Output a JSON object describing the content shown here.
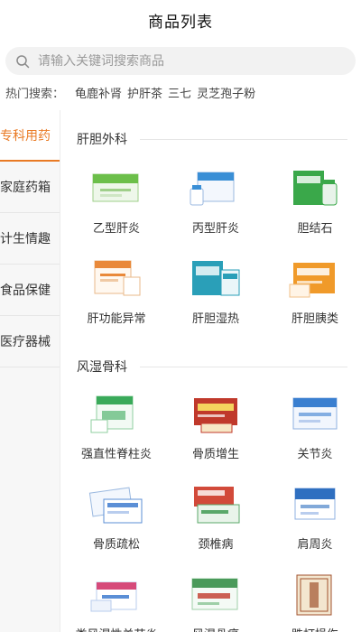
{
  "header": {
    "title": "商品列表"
  },
  "search": {
    "placeholder": "请输入关键词搜索商品",
    "icon": "search-icon"
  },
  "hot": {
    "label": "热门搜索：",
    "items": [
      "龟鹿补肾",
      "护肝茶",
      "三七",
      "灵芝孢子粉"
    ]
  },
  "sidebar": {
    "items": [
      {
        "label": "专科用药",
        "active": true
      },
      {
        "label": "家庭药箱"
      },
      {
        "label": "计生情趣"
      },
      {
        "label": "食品保健"
      },
      {
        "label": "医疗器械"
      }
    ]
  },
  "sections": [
    {
      "title": "肝胆外科",
      "items": [
        {
          "label": "乙型肝炎",
          "icon": "green-drug-box-icon",
          "color": "#6cbf4a"
        },
        {
          "label": "丙型肝炎",
          "icon": "blue-drug-box-bottle-icon",
          "color": "#3a8fd6"
        },
        {
          "label": "胆结石",
          "icon": "green-box-bottle-icon",
          "color": "#3aa84a"
        },
        {
          "label": "肝功能异常",
          "icon": "orange-drug-box-icon",
          "color": "#e9893a"
        },
        {
          "label": "肝胆湿热",
          "icon": "teal-drug-box-icon",
          "color": "#2a9fb8"
        },
        {
          "label": "肝胆胰类",
          "icon": "orange-blister-box-icon",
          "color": "#f09a2a"
        }
      ]
    },
    {
      "title": "风湿骨科",
      "items": [
        {
          "label": "强直性脊柱炎",
          "icon": "green-drug-box-icon",
          "color": "#3aaa5a"
        },
        {
          "label": "骨质增生",
          "icon": "red-drug-box-icon",
          "color": "#c0392b"
        },
        {
          "label": "关节炎",
          "icon": "blue-drug-box-icon",
          "color": "#3a7fd0"
        },
        {
          "label": "骨质疏松",
          "icon": "blister-pack-icon",
          "color": "#5b8fd6"
        },
        {
          "label": "颈椎病",
          "icon": "red-green-box-icon",
          "color": "#d24a3a"
        },
        {
          "label": "肩周炎",
          "icon": "blue-white-box-icon",
          "color": "#2f6fc0"
        },
        {
          "label": "类风湿性关节炎",
          "icon": "pink-blue-box-icon",
          "color": "#d64a7a"
        },
        {
          "label": "风湿骨痛",
          "icon": "green-red-box-icon",
          "color": "#4a9a5a"
        },
        {
          "label": "跌打损伤",
          "icon": "brown-box-icon",
          "color": "#a0522d"
        }
      ]
    }
  ]
}
